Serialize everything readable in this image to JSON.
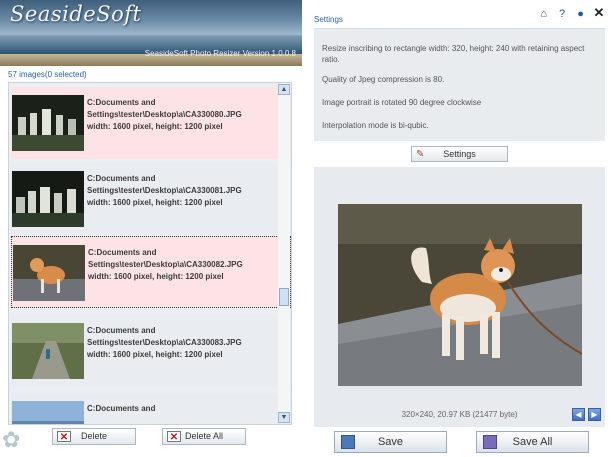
{
  "banner": {
    "logo": "SeasideSoft",
    "version": "SeasideSoft Photo Resizer Version 1.0.0.8"
  },
  "list": {
    "count": "57 images(0 selected)",
    "items": [
      {
        "path1": "C:Documents and",
        "path2": "Settings\\tester\\Desktop\\a\\CA330080.JPG",
        "dims": "width: 1600 pixel, height: 1200 pixel"
      },
      {
        "path1": "C:Documents and",
        "path2": "Settings\\tester\\Desktop\\a\\CA330081.JPG",
        "dims": "width: 1600 pixel, height: 1200 pixel"
      },
      {
        "path1": "C:Documents and",
        "path2": "Settings\\tester\\Desktop\\a\\CA330082.JPG",
        "dims": "width: 1600 pixel, height: 1200 pixel"
      },
      {
        "path1": "C:Documents and",
        "path2": "Settings\\tester\\Desktop\\a\\CA330083.JPG",
        "dims": "width: 1600 pixel, height: 1200 pixel"
      },
      {
        "path1": "C:Documents and",
        "path2": "",
        "dims": ""
      }
    ],
    "scroll_up": "▲",
    "scroll_down": "▼"
  },
  "buttons": {
    "delete": "Delete",
    "delete_all": "Delete All",
    "save": "Save",
    "save_all": "Save All",
    "settings": "Settings"
  },
  "settings": {
    "title": "Settings",
    "lines": [
      "Resize inscribing to rectangle width: 320, height: 240 with retaining aspect ratio.",
      "Quality of Jpeg compression is 80.",
      "Image portrait is rotated 90 degree clockwise",
      "Interpolation mode is bi-qubic."
    ]
  },
  "preview": {
    "info": "320×240, 20.97 KB (21477 byte)",
    "prev": "◀",
    "next": "▶"
  },
  "top_icons": {
    "home": "⌂",
    "help": "?",
    "info": "●",
    "close": "✕"
  }
}
